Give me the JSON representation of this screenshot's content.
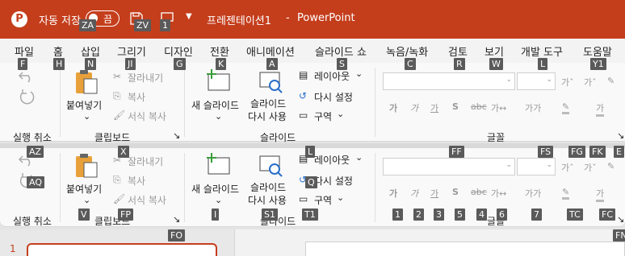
{
  "title": {
    "autosave": "자동 저장",
    "toggle": "끔",
    "doc": "프레젠테이션1",
    "sep": "-",
    "app": "PowerPoint"
  },
  "tabs": {
    "file": "파일",
    "home": "홈",
    "insert": "삽입",
    "draw": "그리기",
    "design": "디자인",
    "transitions": "전환",
    "animations": "애니메이션",
    "slideshow": "슬라이드 쇼",
    "record": "녹음/녹화",
    "review": "검토",
    "view": "보기",
    "developer": "개발 도구",
    "help": "도움말"
  },
  "ribbon": {
    "undo_group": "실행 취소",
    "paste": "붙여넣기",
    "cut": "잘라내기",
    "copy": "복사",
    "format_painter": "서식 복사",
    "clipboard_group": "클립보드",
    "new_slide_1": "새 슬라이드",
    "reuse_1": "슬라이드",
    "reuse_2": "다시 사용",
    "layout": "레이아웃",
    "reset": "다시 설정",
    "section": "구역",
    "slides_group": "슬라이드",
    "font_group": "글꼴"
  },
  "keytips": {
    "za": "ZA",
    "zv": "ZV",
    "one": "1",
    "f": "F",
    "h": "H",
    "n": "N",
    "ji": "JI",
    "g": "G",
    "k": "K",
    "a": "A",
    "s": "S",
    "c": "C",
    "r": "R",
    "w": "W",
    "l": "L",
    "y1": "Y1",
    "az": "AZ",
    "x": "X",
    "ff": "FF",
    "fs": "FS",
    "fg": "FG",
    "fk": "FK",
    "e": "E",
    "aq": "AQ",
    "v": "V",
    "fp": "FP",
    "i": "I",
    "s1": "S1",
    "t1": "T1",
    "ql": "L",
    "q": "Q",
    "b1": "1",
    "b2": "2",
    "b3": "3",
    "b5": "5",
    "b4": "4",
    "b6": "6",
    "b7": "7",
    "tc": "TC",
    "fc": "FC",
    "fo": "FO",
    "fn": "FN"
  },
  "slide_num": "1",
  "colors": {
    "brand": "#c43e1c",
    "keytip": "#5a5a5a"
  }
}
